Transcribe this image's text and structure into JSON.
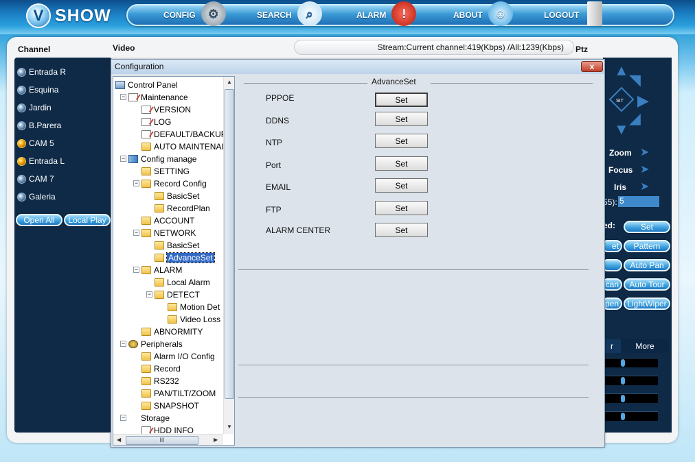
{
  "app": {
    "logo_letter": "V",
    "logo_text": "SHOW"
  },
  "nav": {
    "items": [
      {
        "label": "CONFIG",
        "icon": "gear-icon"
      },
      {
        "label": "SEARCH",
        "icon": "magnifier-icon"
      },
      {
        "label": "ALARM",
        "icon": "siren-icon"
      },
      {
        "label": "ABOUT",
        "icon": "smiley-icon"
      },
      {
        "label": "LOGOUT",
        "icon": "door-icon"
      }
    ]
  },
  "headers": {
    "channel": "Channel",
    "video": "Video",
    "stream": "Stream:Current channel:419(Kbps) /All:1239(Kbps)",
    "ptz": "Ptz"
  },
  "channels": [
    {
      "name": "Entrada R",
      "active": false
    },
    {
      "name": "Esquina",
      "active": false
    },
    {
      "name": "Jardin",
      "active": false
    },
    {
      "name": "B.Parera",
      "active": false
    },
    {
      "name": "CAM 5",
      "active": true
    },
    {
      "name": "Entrada L",
      "active": true
    },
    {
      "name": "CAM 7",
      "active": false
    },
    {
      "name": "Galeria",
      "active": false
    }
  ],
  "channel_buttons": {
    "open_all": "Open All",
    "local_play": "Local Play"
  },
  "ptz": {
    "zoom": "Zoom",
    "focus": "Focus",
    "iris": "Iris",
    "value_label": "55):",
    "value": "5",
    "speed_label": "ed:",
    "set": "Set",
    "btn_et": "et",
    "pattern": "Pattern",
    "auto_pan": "Auto Pan",
    "btn_can": "can",
    "auto_tour": "Auto Tour",
    "btn_pen": "pen",
    "light_wiper": "LightWiper",
    "tab_r": "r",
    "tab_more": "More",
    "center_label": "SIT"
  },
  "dialog": {
    "title": "Configuration",
    "close": "x",
    "section_title": "AdvanceSet",
    "rows": [
      {
        "label": "PPPOE",
        "button": "Set"
      },
      {
        "label": "DDNS",
        "button": "Set"
      },
      {
        "label": "NTP",
        "button": "Set"
      },
      {
        "label": "Port",
        "button": "Set"
      },
      {
        "label": "EMAIL",
        "button": "Set"
      },
      {
        "label": "FTP",
        "button": "Set"
      },
      {
        "label": "ALARM CENTER",
        "button": "Set"
      }
    ]
  },
  "tree": [
    {
      "label": "Control Panel",
      "icon": "pc"
    },
    {
      "label": "Maintenance",
      "icon": "doc"
    },
    {
      "label": "VERSION",
      "icon": "doc"
    },
    {
      "label": "LOG",
      "icon": "doc"
    },
    {
      "label": "DEFAULT/BACKUP",
      "icon": "doc"
    },
    {
      "label": "AUTO MAINTENAI",
      "icon": "folder"
    },
    {
      "label": "Config manage",
      "icon": "tool"
    },
    {
      "label": "SETTING",
      "icon": "folder"
    },
    {
      "label": "Record Config",
      "icon": "folder"
    },
    {
      "label": "BasicSet",
      "icon": "folder"
    },
    {
      "label": "RecordPlan",
      "icon": "folder"
    },
    {
      "label": "ACCOUNT",
      "icon": "folder"
    },
    {
      "label": "NETWORK",
      "icon": "folder"
    },
    {
      "label": "BasicSet",
      "icon": "folder"
    },
    {
      "label": "AdvanceSet",
      "icon": "folder"
    },
    {
      "label": "ALARM",
      "icon": "folder"
    },
    {
      "label": "Local Alarm",
      "icon": "folder"
    },
    {
      "label": "DETECT",
      "icon": "folder"
    },
    {
      "label": "Motion Det",
      "icon": "folder"
    },
    {
      "label": "Video Loss",
      "icon": "folder"
    },
    {
      "label": "ABNORMITY",
      "icon": "folder"
    },
    {
      "label": "Peripherals",
      "icon": "gears"
    },
    {
      "label": "Alarm I/O Config",
      "icon": "folder"
    },
    {
      "label": "Record",
      "icon": "folder"
    },
    {
      "label": "RS232",
      "icon": "folder"
    },
    {
      "label": "PAN/TILT/ZOOM",
      "icon": "folder"
    },
    {
      "label": "SNAPSHOT",
      "icon": "folder"
    },
    {
      "label": "Storage",
      "icon": "none"
    },
    {
      "label": "HDD INFO",
      "icon": "doc"
    }
  ],
  "tree_scroll": {
    "h_thumb": "III"
  },
  "colors": {
    "accent": "#3fa3e0",
    "dark_panel": "#0e2a47",
    "selection": "#3168c6"
  }
}
